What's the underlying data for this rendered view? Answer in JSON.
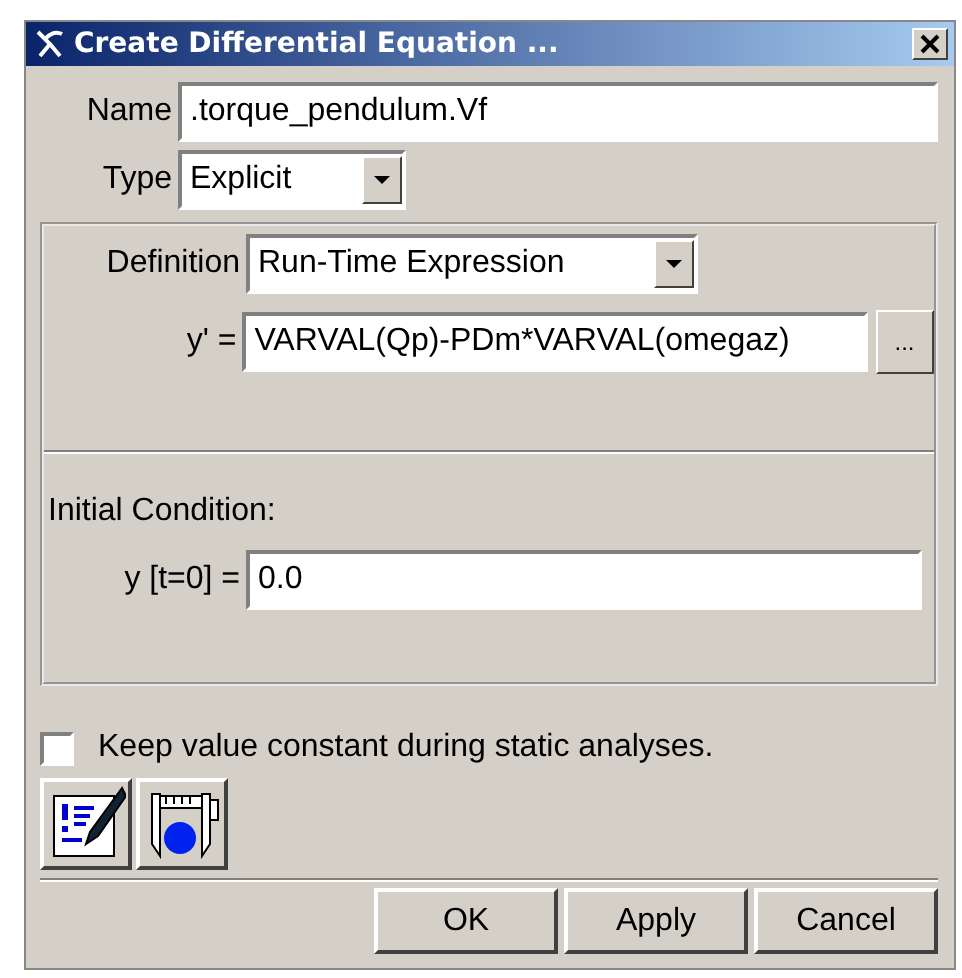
{
  "window": {
    "title": "Create Differential Equation ..."
  },
  "name": {
    "label": "Name",
    "value": ".torque_pendulum.Vf"
  },
  "type": {
    "label": "Type",
    "value": "Explicit"
  },
  "definition": {
    "label": "Definition",
    "value": "Run-Time Expression"
  },
  "expression": {
    "label": "y' =",
    "value": "VARVAL(Qp)-PDm*VARVAL(omegaz)",
    "browse": "..."
  },
  "initial_condition": {
    "heading": "Initial Condition:",
    "label": "y [t=0] =",
    "value": "0.0"
  },
  "keep_constant": {
    "label": "Keep value constant during static analyses.",
    "checked": false
  },
  "buttons": [
    "OK",
    "Apply",
    "Cancel"
  ]
}
